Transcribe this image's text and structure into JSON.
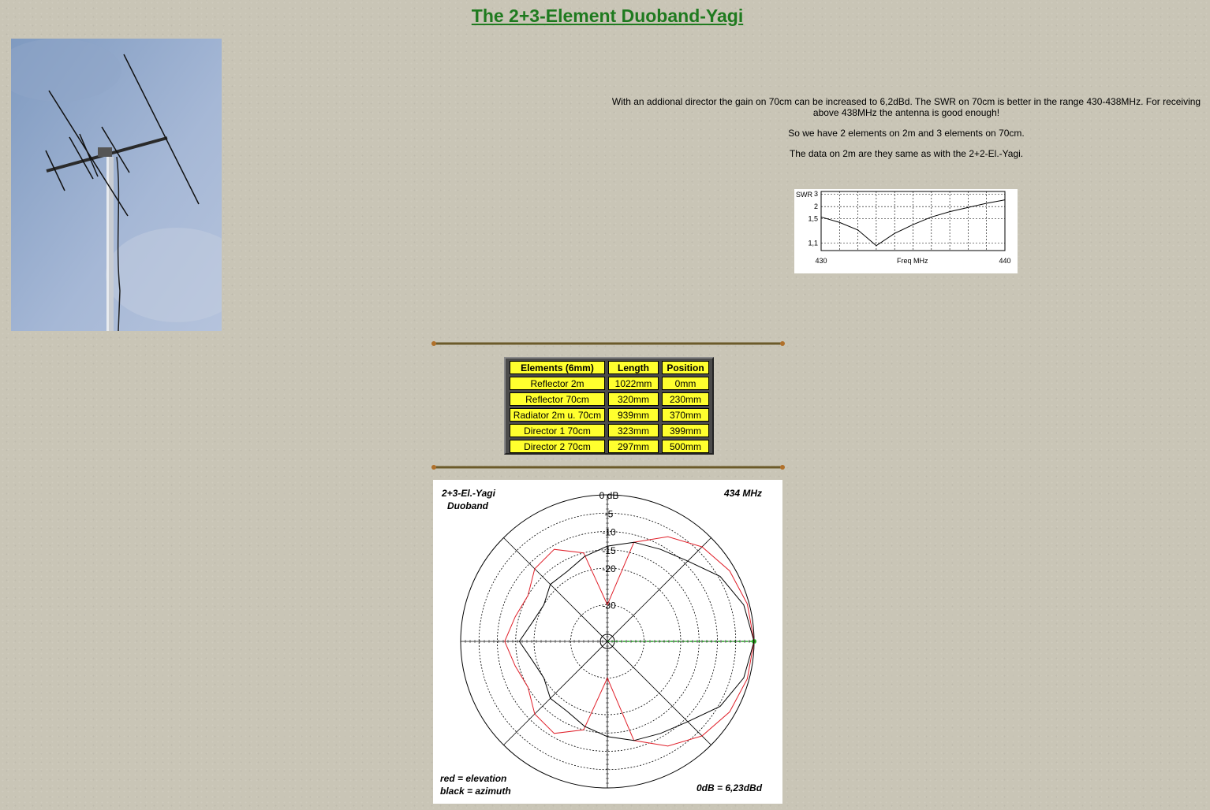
{
  "page": {
    "title": "The 2+3-Element Duoband-Yagi"
  },
  "photo": {
    "icon": "yagi-antenna-photo"
  },
  "description": {
    "p1": "With an addional director the gain on 70cm can be increased to 6,2dBd. The SWR on 70cm is better in the range 430-438MHz. For receiving above 438MHz the antenna is good enough!",
    "p2": "So we have 2 elements on 2m and 3 elements on 70cm.",
    "p3": "The data on 2m are they same as with the 2+2-El.-Yagi."
  },
  "swr_chart": {
    "ylabel": "SWR",
    "xlabel": "Freq MHz",
    "y_ticks": [
      "3",
      "2",
      "1,5",
      "1,1"
    ],
    "x_ticks": [
      "430",
      "440"
    ]
  },
  "elements_table": {
    "headers": [
      "Elements (6mm)",
      "Length",
      "Position"
    ],
    "rows": [
      [
        "Reflector 2m",
        "1022mm",
        "0mm"
      ],
      [
        "Reflector 70cm",
        "320mm",
        "230mm"
      ],
      [
        "Radiator 2m u. 70cm",
        "939mm",
        "370mm"
      ],
      [
        "Director 1  70cm",
        "323mm",
        "399mm"
      ],
      [
        "Director 2  70cm",
        "297mm",
        "500mm"
      ]
    ]
  },
  "polar_chart": {
    "title_line1": "2+3-El.-Yagi",
    "title_line2": "Duoband",
    "frequency": "434 MHz",
    "ring_labels": [
      "0 dB",
      "-5",
      "-10",
      "-15",
      "-20",
      "-30"
    ],
    "legend_red": "red = elevation",
    "legend_black": "black = azimuth",
    "reference": "0dB = 6,23dBd",
    "colors": {
      "elevation": "#e0202a",
      "azimuth": "#000000",
      "axis": "#22aa22"
    }
  },
  "chart_data": [
    {
      "type": "line",
      "xlabel": "Freq MHz",
      "ylabel": "SWR",
      "x": [
        430,
        431,
        432,
        433,
        434,
        435,
        436,
        437,
        438,
        439,
        440
      ],
      "series": [
        {
          "values": [
            1.55,
            1.4,
            1.25,
            1.08,
            1.2,
            1.35,
            1.55,
            1.75,
            1.95,
            2.2,
            2.45
          ]
        }
      ],
      "xlim": [
        430,
        440
      ],
      "y_ticks": [
        1.1,
        1.5,
        2,
        3
      ],
      "grid": true
    },
    {
      "type": "polar",
      "title": "2+3-El.-Yagi Duoband",
      "rings_db": [
        0,
        -5,
        -10,
        -15,
        -20,
        -30
      ],
      "series": [
        {
          "name": "elevation",
          "color": "#e0202a",
          "angles_deg": [
            0,
            15,
            30,
            45,
            60,
            75,
            90,
            105,
            120,
            135,
            150,
            165,
            180,
            195,
            210,
            225,
            240,
            255,
            270,
            285,
            300,
            315,
            330,
            345
          ],
          "gain_db": [
            0,
            -0.5,
            -1.5,
            -3.5,
            -7,
            -12,
            -30,
            -15,
            -11,
            -12,
            -15,
            -14,
            -12,
            -14,
            -15,
            -12,
            -11,
            -15,
            -30,
            -12,
            -7,
            -3.5,
            -1.5,
            -0.5
          ]
        },
        {
          "name": "azimuth",
          "color": "#000000",
          "angles_deg": [
            0,
            15,
            30,
            45,
            60,
            75,
            90,
            105,
            120,
            135,
            150,
            165,
            180,
            195,
            210,
            225,
            240,
            255,
            270,
            285,
            300,
            315,
            330,
            345
          ],
          "gain_db": [
            0,
            -1.5,
            -4.5,
            -9,
            -11,
            -12,
            -14,
            -16,
            -18,
            -18,
            -20,
            -19,
            -16,
            -19,
            -20,
            -18,
            -18,
            -16,
            -14,
            -12,
            -11,
            -9,
            -4.5,
            -1.5
          ]
        }
      ]
    }
  ]
}
